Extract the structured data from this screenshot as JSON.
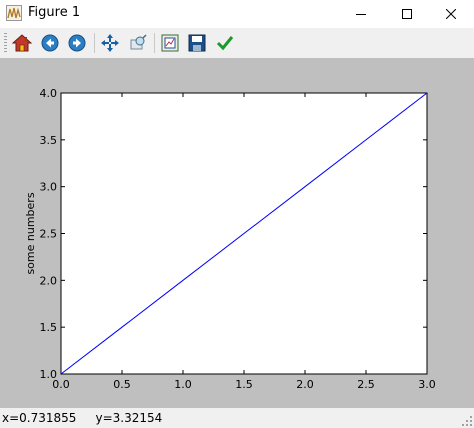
{
  "window": {
    "title": "Figure 1"
  },
  "toolbar": {
    "buttons": [
      {
        "name": "home",
        "icon": "home-icon"
      },
      {
        "name": "back",
        "icon": "back-arrow-icon"
      },
      {
        "name": "forward",
        "icon": "forward-arrow-icon"
      },
      {
        "name": "pan",
        "icon": "move-arrows-icon"
      },
      {
        "name": "zoom",
        "icon": "zoom-rect-icon"
      },
      {
        "name": "configure-subplots",
        "icon": "subplots-icon"
      },
      {
        "name": "save",
        "icon": "floppy-disk-icon"
      },
      {
        "name": "edit-parameters",
        "icon": "checkmark-icon"
      }
    ]
  },
  "status": {
    "coords": "x=0.731855     y=3.32154"
  },
  "colors": {
    "figure_bg": "#bfbfbf",
    "line": "#0000ff",
    "axes_bg": "#ffffff"
  },
  "chart_data": {
    "type": "line",
    "title": "",
    "xlabel": "",
    "ylabel": "some numbers",
    "xlim": [
      0.0,
      3.0
    ],
    "ylim": [
      1.0,
      4.0
    ],
    "xticks": [
      "0.0",
      "0.5",
      "1.0",
      "1.5",
      "2.0",
      "2.5",
      "3.0"
    ],
    "yticks": [
      "1.0",
      "1.5",
      "2.0",
      "2.5",
      "3.0",
      "3.5",
      "4.0"
    ],
    "xtick_values": [
      0.0,
      0.5,
      1.0,
      1.5,
      2.0,
      2.5,
      3.0
    ],
    "ytick_values": [
      1.0,
      1.5,
      2.0,
      2.5,
      3.0,
      3.5,
      4.0
    ],
    "series": [
      {
        "x": [
          0,
          1,
          2,
          3
        ],
        "y": [
          1,
          2,
          3,
          4
        ]
      }
    ],
    "grid": false,
    "legend": "none"
  }
}
